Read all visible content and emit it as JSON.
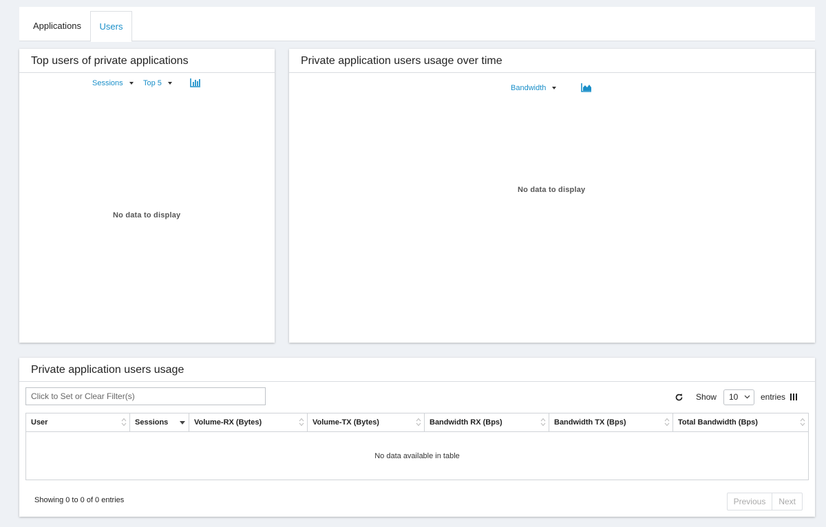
{
  "tabs": [
    {
      "label": "Applications",
      "active": false
    },
    {
      "label": "Users",
      "active": true
    }
  ],
  "colors": {
    "accent": "#1a8fc9",
    "background": "#eef1f5"
  },
  "top_users": {
    "title": "Top users of private applications",
    "metric_dropdown": "Sessions",
    "limit_dropdown": "Top 5",
    "chart_icon": "bar-chart-icon",
    "empty_text": "No data to display"
  },
  "usage_over_time": {
    "title": "Private application users usage over time",
    "metric_dropdown": "Bandwidth",
    "chart_icon": "area-chart-icon",
    "empty_text": "No data to display"
  },
  "usage_table": {
    "title": "Private application users usage",
    "filter_placeholder": "Click to Set or Clear Filter(s)",
    "show_label": "Show",
    "page_size": "10",
    "entries_label": "entries",
    "columns": [
      "User",
      "Sessions",
      "Volume-RX (Bytes)",
      "Volume-TX (Bytes)",
      "Bandwidth RX (Bps)",
      "Bandwidth TX (Bps)",
      "Total Bandwidth (Bps)"
    ],
    "empty_text": "No data available in table",
    "info": "Showing 0 to 0 of 0 entries",
    "previous_label": "Previous",
    "next_label": "Next"
  }
}
